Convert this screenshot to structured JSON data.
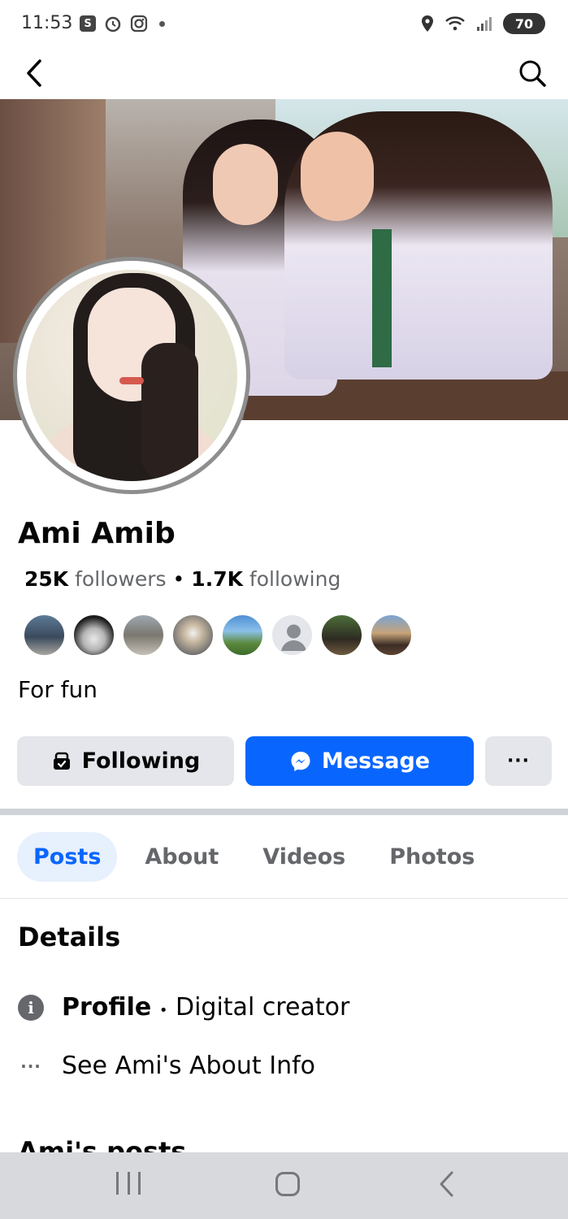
{
  "status_bar": {
    "time": "11:53",
    "app_badge": "S",
    "battery": "70"
  },
  "profile": {
    "name": "Ami Amib",
    "followers_count": "25K",
    "followers_label": "followers",
    "separator": "•",
    "following_count": "1.7K",
    "following_label": "following",
    "bio": "For fun"
  },
  "actions": {
    "following_label": "Following",
    "message_label": "Message",
    "more_label": "···"
  },
  "tabs": [
    {
      "label": "Posts",
      "active": true
    },
    {
      "label": "About",
      "active": false
    },
    {
      "label": "Videos",
      "active": false
    },
    {
      "label": "Photos",
      "active": false
    }
  ],
  "details": {
    "title": "Details",
    "profile_label": "Profile",
    "profile_sep": "•",
    "profile_value": "Digital creator",
    "about_link": "See Ami's About Info",
    "next_section_title": "Ami's posts"
  },
  "icons": {
    "back": "back-arrow-icon",
    "search": "search-icon",
    "following": "following-icon",
    "messenger": "messenger-icon",
    "info": "info-icon",
    "more": "ellipsis-icon"
  },
  "colors": {
    "accent": "#0866ff",
    "button_gray": "#e4e6eb",
    "secondary_text": "#65676b",
    "active_tab_bg": "#e7f0fd"
  }
}
